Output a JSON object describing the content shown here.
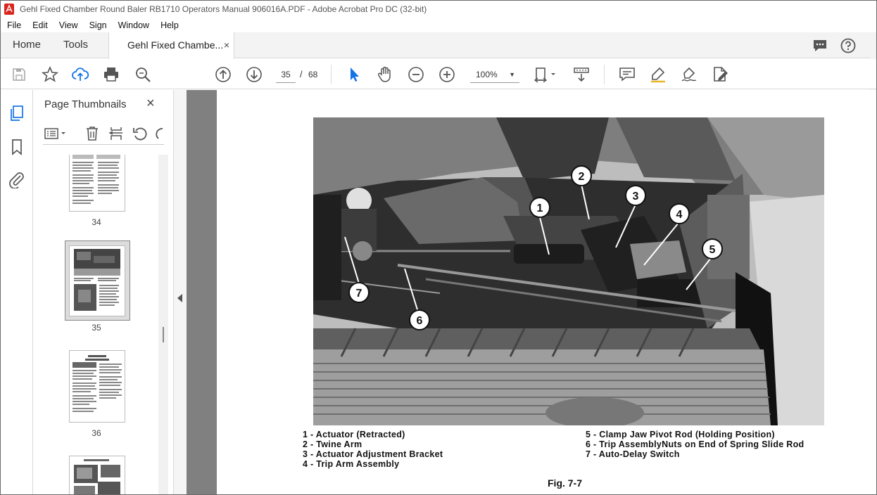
{
  "window": {
    "title": "Gehl Fixed Chamber Round Baler RB1710 Operators Manual 906016A.PDF - Adobe Acrobat Pro DC (32-bit)"
  },
  "menu": [
    "File",
    "Edit",
    "View",
    "Sign",
    "Window",
    "Help"
  ],
  "tabs": {
    "home": "Home",
    "tools": "Tools",
    "document": "Gehl Fixed Chambe...",
    "close": "×"
  },
  "toolbar": {
    "page_current": "35",
    "page_sep": "/",
    "page_total": "68",
    "zoom": "100%"
  },
  "panel": {
    "title": "Page Thumbnails",
    "close": "×",
    "thumbs": [
      {
        "label": "34"
      },
      {
        "label": "35"
      },
      {
        "label": "36"
      }
    ]
  },
  "document": {
    "captions_left": [
      "1 - Actuator (Retracted)",
      "2 - Twine Arm",
      "3 - Actuator Adjustment Bracket",
      "4 - Trip Arm Assembly"
    ],
    "captions_right": [
      "5 - Clamp Jaw Pivot Rod (Holding Position)",
      "6 - Trip AssemblyNuts on End of Spring Slide Rod",
      "7 - Auto-Delay Switch"
    ],
    "figure_label": "Fig. 7-7",
    "callouts": [
      "1",
      "2",
      "3",
      "4",
      "5",
      "6",
      "7"
    ]
  },
  "colors": {
    "accent": "#1473e6",
    "icon": "#555555",
    "doc_bg": "#808080"
  }
}
